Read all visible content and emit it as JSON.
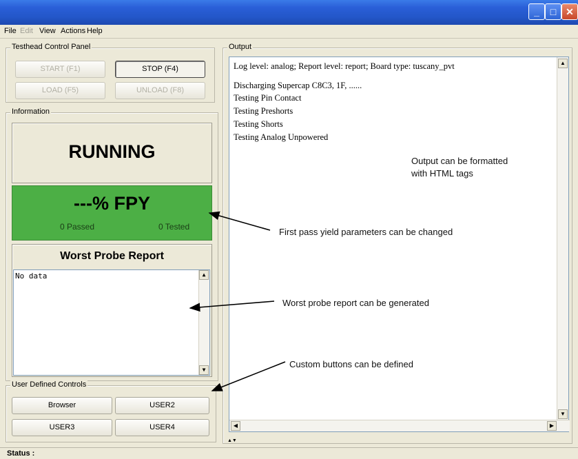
{
  "window": {
    "minimize_glyph": "_",
    "maximize_glyph": "□",
    "close_glyph": "✕"
  },
  "menu": [
    "File",
    "Edit",
    "View",
    "Actions",
    "Help"
  ],
  "testhead": {
    "title": "Testhead Control Panel",
    "start": "START (F1)",
    "stop": "STOP (F4)",
    "load": "LOAD (F5)",
    "unload": "UNLOAD (F8)"
  },
  "information": {
    "title": "Information",
    "status": "RUNNING",
    "fpy": "---% FPY",
    "passed": "0 Passed",
    "tested": "0 Tested",
    "fpy_color": "#4caf45"
  },
  "worst_probe": {
    "title": "Worst Probe Report",
    "content": "No data"
  },
  "user_controls": {
    "title": "User Defined Controls",
    "buttons": [
      "Browser",
      "USER2",
      "USER3",
      "USER4"
    ]
  },
  "output": {
    "title": "Output",
    "lines": [
      "Log level: analog; Report level: report; Board type: tuscany_pvt",
      "Discharging Supercap C8C3, 1F, ......",
      "Testing Pin Contact",
      "Testing Preshorts",
      "Testing Shorts",
      "Testing Analog Unpowered"
    ]
  },
  "annotations": {
    "output_format_1": "Output can be formatted",
    "output_format_2": "with HTML tags",
    "fpy": "First pass yield parameters can be changed",
    "worst_probe": "Worst probe report can be generated",
    "custom_buttons": "Custom buttons can be defined"
  },
  "status": {
    "label": "Status :"
  }
}
